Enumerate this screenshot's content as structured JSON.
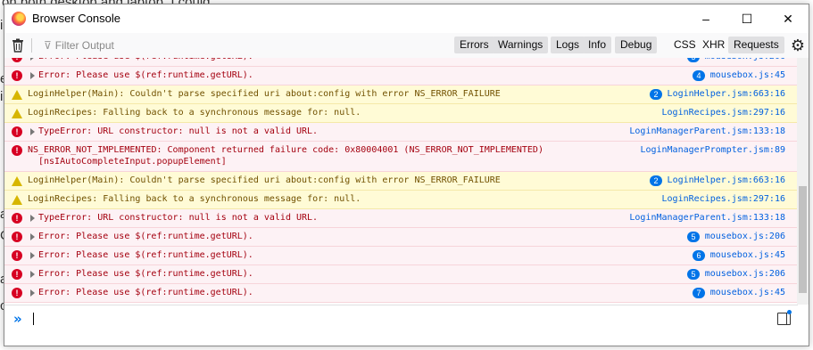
{
  "window": {
    "title": "Browser Console",
    "minimize": "–",
    "maximize": "☐",
    "close": "✕"
  },
  "background_text": [
    "on both desktop and laptop. I could",
    "i",
    "e",
    "i",
    "a",
    "C",
    "a",
    "c"
  ],
  "toolbar": {
    "filter_placeholder": "Filter Output",
    "buttons": [
      "Errors",
      "Warnings",
      "Logs",
      "Info",
      "Debug"
    ],
    "buttons2": [
      "CSS",
      "XHR",
      "Requests"
    ]
  },
  "logs": [
    {
      "type": "error",
      "arrow": true,
      "text": "Error: Please use $(ref:runtime.getURL).",
      "badge": "5",
      "src": "mousebox.js:206"
    },
    {
      "type": "error",
      "arrow": true,
      "text": "Error: Please use $(ref:runtime.getURL).",
      "badge": "4",
      "src": "mousebox.js:45"
    },
    {
      "type": "warn",
      "arrow": false,
      "text": "LoginHelper(Main): Couldn't parse specified uri about:config with error NS_ERROR_FAILURE",
      "badge": "2",
      "src": "LoginHelper.jsm:663:16"
    },
    {
      "type": "warn",
      "arrow": false,
      "text": "LoginRecipes: Falling back to a synchronous message for: null.",
      "badge": "",
      "src": "LoginRecipes.jsm:297:16"
    },
    {
      "type": "error",
      "arrow": true,
      "text": "TypeError: URL constructor: null is not a valid URL.",
      "badge": "",
      "src": "LoginManagerParent.jsm:133:18"
    },
    {
      "type": "error",
      "arrow": false,
      "text": "NS_ERROR_NOT_IMPLEMENTED: Component returned failure code: 0x80004001 (NS_ERROR_NOT_IMPLEMENTED)",
      "text2": "[nsIAutoCompleteInput.popupElement]",
      "badge": "",
      "src": "LoginManagerPrompter.jsm:89"
    },
    {
      "type": "warn",
      "arrow": false,
      "text": "LoginHelper(Main): Couldn't parse specified uri about:config with error NS_ERROR_FAILURE",
      "badge": "2",
      "src": "LoginHelper.jsm:663:16"
    },
    {
      "type": "warn",
      "arrow": false,
      "text": "LoginRecipes: Falling back to a synchronous message for: null.",
      "badge": "",
      "src": "LoginRecipes.jsm:297:16"
    },
    {
      "type": "error",
      "arrow": true,
      "text": "TypeError: URL constructor: null is not a valid URL.",
      "badge": "",
      "src": "LoginManagerParent.jsm:133:18"
    },
    {
      "type": "error",
      "arrow": true,
      "text": "Error: Please use $(ref:runtime.getURL).",
      "badge": "5",
      "src": "mousebox.js:206"
    },
    {
      "type": "error",
      "arrow": true,
      "text": "Error: Please use $(ref:runtime.getURL).",
      "badge": "6",
      "src": "mousebox.js:45"
    },
    {
      "type": "error",
      "arrow": true,
      "text": "Error: Please use $(ref:runtime.getURL).",
      "badge": "5",
      "src": "mousebox.js:206"
    },
    {
      "type": "error",
      "arrow": true,
      "text": "Error: Please use $(ref:runtime.getURL).",
      "badge": "7",
      "src": "mousebox.js:45"
    }
  ],
  "input": {
    "prompt": "»",
    "value": ""
  }
}
